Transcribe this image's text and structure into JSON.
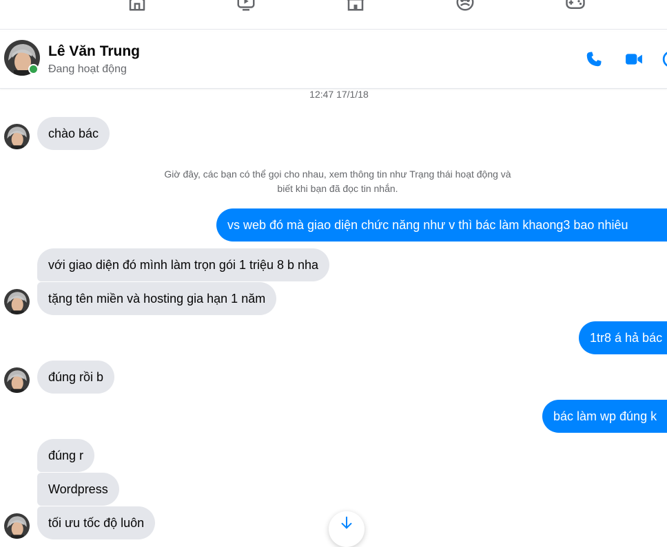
{
  "nav": {
    "icons": [
      "home-icon",
      "watch-icon",
      "marketplace-icon",
      "groups-icon",
      "gaming-icon"
    ]
  },
  "header": {
    "name": "Lê Văn Trung",
    "status": "Đang hoạt động",
    "status_color": "#31a24c",
    "accent_color": "#0084ff",
    "actions": [
      "phone-icon",
      "video-icon",
      "info-icon"
    ]
  },
  "conversation": {
    "timestamp": "12:47 17/1/18",
    "system_note_line1": "Giờ đây, các bạn có thể gọi cho nhau, xem thông tin như Trạng thái hoạt động và",
    "system_note_line2": "biết khi bạn đã đọc tin nhắn.",
    "messages": [
      {
        "from": "contact",
        "text": "chào bác"
      },
      {
        "from": "me",
        "text": "vs web đó mà giao diện chức năng như v thì bác làm khaong3 bao nhiêu"
      },
      {
        "from": "contact",
        "text": "với giao diện đó mình làm trọn gói 1 triệu 8 b nha"
      },
      {
        "from": "contact",
        "text": "tặng tên miền và hosting gia hạn 1 năm"
      },
      {
        "from": "me",
        "text": "1tr8 á hả bác"
      },
      {
        "from": "contact",
        "text": "đúng rồi b"
      },
      {
        "from": "me",
        "text": "bác làm wp đúng k"
      },
      {
        "from": "contact",
        "text": "đúng r"
      },
      {
        "from": "contact",
        "text": "Wordpress"
      },
      {
        "from": "contact",
        "text": "tối ưu tốc độ luôn"
      }
    ]
  },
  "scroll_down": {
    "icon": "arrow-down-icon"
  }
}
